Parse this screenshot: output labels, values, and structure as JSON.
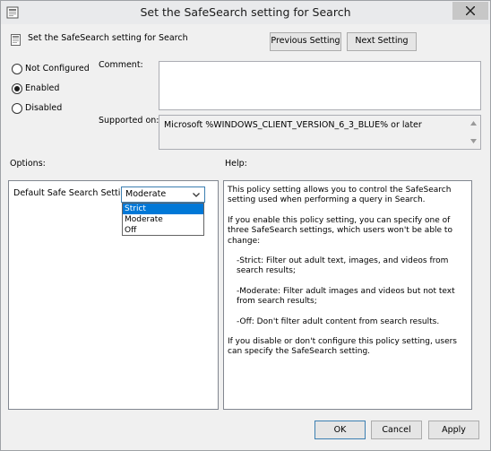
{
  "window": {
    "title": "Set the SafeSearch setting for Search"
  },
  "header": {
    "policy_name": "Set the SafeSearch setting for Search",
    "previous_label": "Previous Setting",
    "next_label": "Next Setting"
  },
  "state": {
    "options": [
      {
        "label": "Not Configured",
        "selected": false
      },
      {
        "label": "Enabled",
        "selected": true
      },
      {
        "label": "Disabled",
        "selected": false
      }
    ]
  },
  "comment": {
    "label": "Comment:",
    "value": ""
  },
  "supported": {
    "label": "Supported on:",
    "value": "Microsoft %WINDOWS_CLIENT_VERSION_6_3_BLUE% or later"
  },
  "options_section": {
    "title": "Options:",
    "setting_label": "Default Safe Search Setting",
    "selected_value": "Moderate",
    "dropdown_items": [
      "Strict",
      "Moderate",
      "Off"
    ],
    "highlighted_item": "Strict"
  },
  "help_section": {
    "title": "Help:",
    "paragraphs": [
      "This policy setting allows you to control the SafeSearch setting used when performing a query in Search.",
      "If you enable this policy setting, you can specify one of three SafeSearch settings, which users won't be able to change:",
      "-Strict: Filter out adult text, images, and videos from search results;",
      "-Moderate: Filter adult images and videos but not text from search results;",
      "-Off: Don't filter adult content from search results.",
      "If you disable or don't configure this policy setting, users can specify the SafeSearch setting."
    ]
  },
  "footer": {
    "ok_label": "OK",
    "cancel_label": "Cancel",
    "apply_label": "Apply"
  },
  "colors": {
    "window_bg": "#f0f0f0",
    "selection": "#0078d7",
    "focus_border": "#3c7fb1"
  }
}
